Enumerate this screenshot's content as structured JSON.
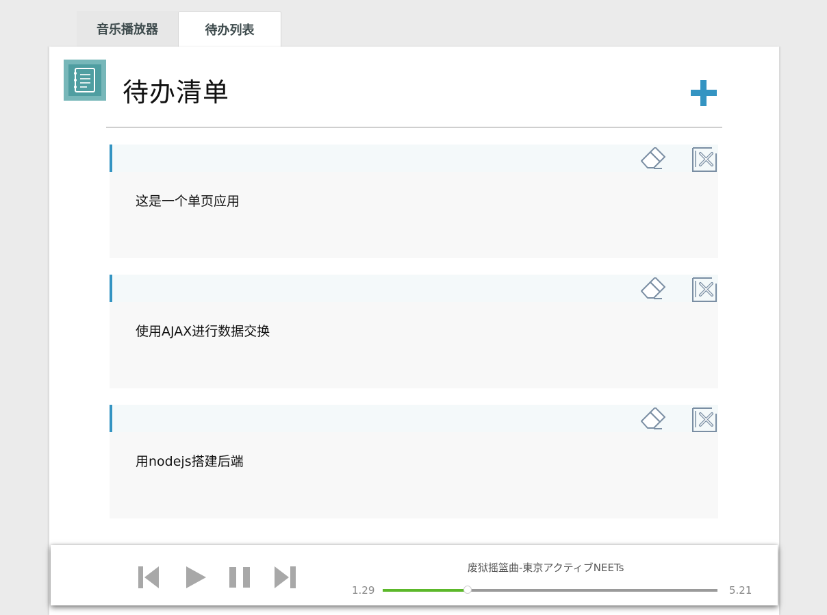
{
  "tabs": [
    {
      "label": "音乐播放器",
      "active": false
    },
    {
      "label": "待办列表",
      "active": true
    }
  ],
  "header": {
    "title": "待办清单",
    "logo_icon": "notebook-icon",
    "add_icon": "plus-icon"
  },
  "todos": [
    {
      "text": "这是一个单页应用"
    },
    {
      "text": "使用AJAX进行数据交换"
    },
    {
      "text": "用nodejs搭建后端"
    }
  ],
  "player": {
    "song": "废狱摇篮曲-東京アクティブNEETs",
    "current_time": "1.29",
    "total_time": "5.21",
    "progress_fraction": 0.254,
    "controls": [
      "previous-icon",
      "play-icon",
      "pause-icon",
      "next-icon"
    ]
  },
  "colors": {
    "accent_blue": "#3494c2",
    "progress_green": "#5cb82a",
    "logo_teal": "#77b7b9"
  }
}
